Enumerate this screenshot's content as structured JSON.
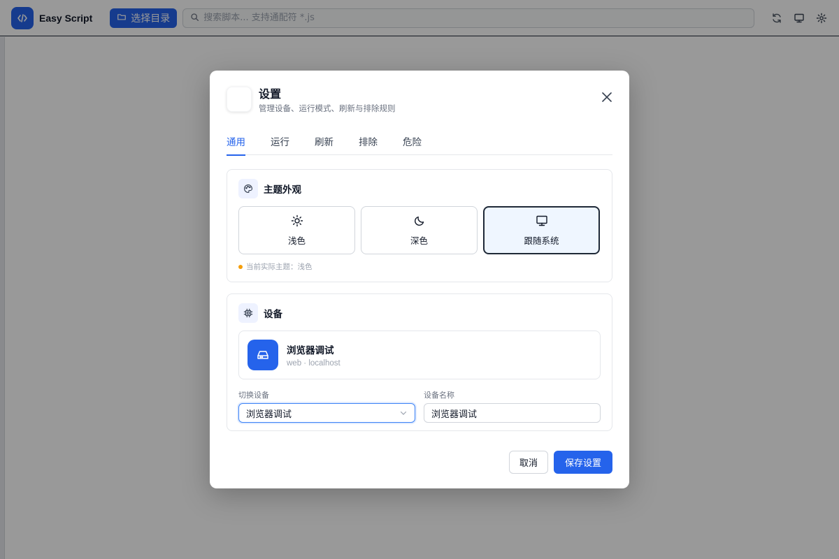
{
  "topbar": {
    "app_title": "Easy Script",
    "select_dir_label": "选择目录",
    "search_placeholder": "搜索脚本... 支持通配符 *.js",
    "icons": [
      "code-icon",
      "folder-icon",
      "search-icon",
      "refresh-icon",
      "monitor-icon",
      "gear-icon"
    ]
  },
  "modal": {
    "title": "设置",
    "subtitle": "管理设备、运行模式、刷新与排除规则",
    "tabs": [
      {
        "label": "通用",
        "active": true
      },
      {
        "label": "运行",
        "active": false
      },
      {
        "label": "刷新",
        "active": false
      },
      {
        "label": "排除",
        "active": false
      },
      {
        "label": "危险",
        "active": false
      }
    ],
    "theme": {
      "title": "主题外观",
      "options": [
        {
          "label": "浅色",
          "icon": "sun-icon",
          "selected": false
        },
        {
          "label": "深色",
          "icon": "moon-icon",
          "selected": false
        },
        {
          "label": "跟随系统",
          "icon": "monitor-icon",
          "selected": true
        }
      ],
      "note": "当前实际主题：浅色"
    },
    "device": {
      "title": "设备",
      "name": "浏览器调试",
      "meta": "web · localhost",
      "switch_label": "切换设备",
      "switch_value": "浏览器调试",
      "name_label": "设备名称",
      "name_value": "浏览器调试"
    },
    "cancel_label": "取消",
    "save_label": "保存设置"
  },
  "colors": {
    "accent": "#2563eb",
    "overlay": "#000000",
    "note_dot": "#f59e0b"
  }
}
